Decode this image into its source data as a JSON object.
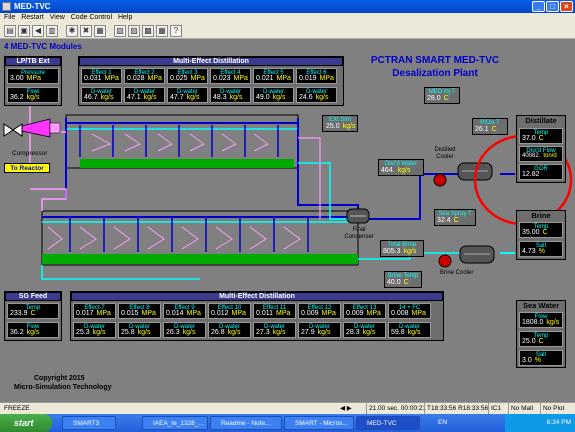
{
  "window": {
    "title": "MED-TVC"
  },
  "menu": [
    "File",
    "Restart",
    "View",
    "Code Control",
    "Help"
  ],
  "toolbar_icons": [
    "open-icon",
    "save-icon",
    "back-icon",
    "print-icon",
    "run-icon",
    "stop-icon",
    "snapshot-icon",
    "chart-icon",
    "trend-icon",
    "grid-icon",
    "table-icon",
    "help-icon"
  ],
  "toolbar_glyphs": [
    "▤",
    "▣",
    "◀",
    "▥",
    "✱",
    "✖",
    "▦",
    "▧",
    "▨",
    "▩",
    "▦",
    "?"
  ],
  "canvas": {
    "modules_label": "4 MED-TVC Modules",
    "title1": "PCTRAN SMART MED-TVC",
    "title2": "Desalization Plant",
    "copyright1": "Copyright 2015",
    "copyright2": "Micro-Simulation Technology",
    "lptb": {
      "title": "LP/TB Ext",
      "pressure_label": "Pressure",
      "pressure_value": "3.00",
      "pressure_unit": "MPa",
      "flow_label": "Flow",
      "flow_value": "36.2",
      "flow_unit": "kg/s"
    },
    "med_top": {
      "title": "Multi-Effect Distillation",
      "effects": [
        {
          "name": "Effect 1",
          "p": "0.031",
          "dw": "46.7"
        },
        {
          "name": "Effect 2",
          "p": "0.028",
          "dw": "47.1"
        },
        {
          "name": "Effect 3",
          "p": "0.025",
          "dw": "47.7"
        },
        {
          "name": "Effect 4",
          "p": "0.023",
          "dw": "48.3"
        },
        {
          "name": "Effect 5",
          "p": "0.021",
          "dw": "49.0"
        },
        {
          "name": "Effect 6",
          "p": "0.019",
          "dw": "24.6"
        }
      ],
      "p_unit": "MPa",
      "dw_label": "D-water",
      "dw_unit": "kg/s"
    },
    "med_bot": {
      "title": "Multi-Effect Distillation",
      "effects": [
        {
          "name": "Effect 7",
          "p": "0.017",
          "dw": "25.3"
        },
        {
          "name": "Effect 8",
          "p": "0.015",
          "dw": "25.8"
        },
        {
          "name": "Effect 9",
          "p": "0.014",
          "dw": "26.3"
        },
        {
          "name": "Effect 10",
          "p": "0.012",
          "dw": "26.8"
        },
        {
          "name": "Effect 11",
          "p": "0.011",
          "dw": "27.3"
        },
        {
          "name": "Effect 12",
          "p": "0.009",
          "dw": "27.9"
        },
        {
          "name": "Effect 13",
          "p": "0.009",
          "dw": "28.3"
        },
        {
          "name": "14 + FC",
          "p": "0.008",
          "dw": "59.8"
        }
      ],
      "p_unit": "MPa",
      "dw_label": "D-water",
      "dw_unit": "kg/s"
    },
    "sg_feed": {
      "title": "SG Feed",
      "temp_label": "Temp",
      "temp_value": "233.9",
      "temp_unit": "C",
      "flow_label": "Flow",
      "flow_value": "36.2",
      "flow_unit": "kg/s"
    },
    "compressor": "Compressor",
    "to_reactor": "To Reactor",
    "ext_stm": {
      "label": "EXt Stm",
      "value": "25.0",
      "unit": "kg/s"
    },
    "med_inj": {
      "label": "MED Inj T",
      "value": "28.0",
      "unit": "C"
    },
    "pdis_t": {
      "label": "P/Dis T",
      "value": "26.1",
      "unit": "C"
    },
    "distd_water": {
      "label": "Dist'd Water",
      "value": "464.",
      "unit": "kg/s"
    },
    "distilled_cooler": "Distilled Cooler",
    "final_condenser": "Final Condenser",
    "sea_spray": {
      "label": "Sea Spray T",
      "value": "32.4",
      "unit": "C"
    },
    "total_brine": {
      "label": "Total Brine",
      "value": "805.3",
      "unit": "kg/s"
    },
    "brine_temp": {
      "label": "Brine Temp",
      "value": "40.0",
      "unit": "C"
    },
    "brine_cooler": "Brine Cooler",
    "distillate": {
      "title": "Distillate",
      "temp_label": "Temp",
      "temp_value": "37.0",
      "temp_unit": "C",
      "flow_label": "Dist'd Flow",
      "flow_value": "40082.",
      "flow_unit": "ton/d",
      "gor_label": "GOR",
      "gor_value": "12.82"
    },
    "brine": {
      "title": "Brine",
      "temp_label": "Temp",
      "temp_value": "35.00",
      "temp_unit": "C",
      "salt_label": "Salt",
      "salt_value": "4.73",
      "salt_unit": "%"
    },
    "sea_water": {
      "title": "Sea Water",
      "flow_label": "Flow",
      "flow_value": "1808.0",
      "flow_unit": "kg/s",
      "temp_label": "Temp",
      "temp_value": "25.0",
      "temp_unit": "C",
      "salt_label": "Salt",
      "salt_value": "3.0",
      "salt_unit": "%"
    }
  },
  "status": {
    "mode": "FREEZE",
    "time": "21.00 sec. 00:00:21",
    "stamp": "T18:33:56 R18:33:56",
    "ic": "IC1",
    "mal": "No Mall",
    "plot": "No Plot"
  },
  "taskbar": {
    "start": "start",
    "tasks": [
      "SMART3",
      "IAEA_te_1326_...",
      "Readme - Note...",
      "SMART - Micros...",
      "MED-TVC"
    ],
    "lang": "EN",
    "clock": "6:34 PM"
  },
  "colors": {
    "titlebar": "#0a5ee6",
    "pink_pipe": "#ff99ff",
    "cyan_pipe": "#00ffff",
    "blue_pipe": "#0000cc",
    "green": "#00aa00",
    "red_circle": "#ff0000"
  }
}
